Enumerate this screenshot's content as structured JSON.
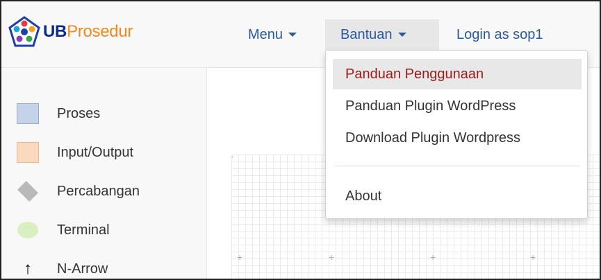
{
  "brand": {
    "prefix": "UB",
    "suffix": "Prosedur"
  },
  "nav": {
    "menu_label": "Menu",
    "help_label": "Bantuan",
    "login_label": "Login as sop1"
  },
  "dropdown": {
    "items": [
      {
        "label": "Panduan Penggunaan"
      },
      {
        "label": "Panduan Plugin WordPress"
      },
      {
        "label": "Download Plugin Wordpress"
      },
      {
        "label": "About"
      }
    ]
  },
  "sidebar": {
    "shapes": [
      {
        "label": "Proses",
        "icon": "process-rectangle-icon"
      },
      {
        "label": "Input/Output",
        "icon": "input-output-icon"
      },
      {
        "label": "Percabangan",
        "icon": "decision-diamond-icon"
      },
      {
        "label": "Terminal",
        "icon": "terminal-ellipse-icon"
      },
      {
        "label": "N-Arrow",
        "icon": "arrow-up-icon"
      }
    ]
  },
  "colors": {
    "brand_blue": "#0b2a8f",
    "brand_orange": "#f08a1d",
    "nav_link": "#2b5a9c",
    "active_item_text": "#a01a1a"
  }
}
